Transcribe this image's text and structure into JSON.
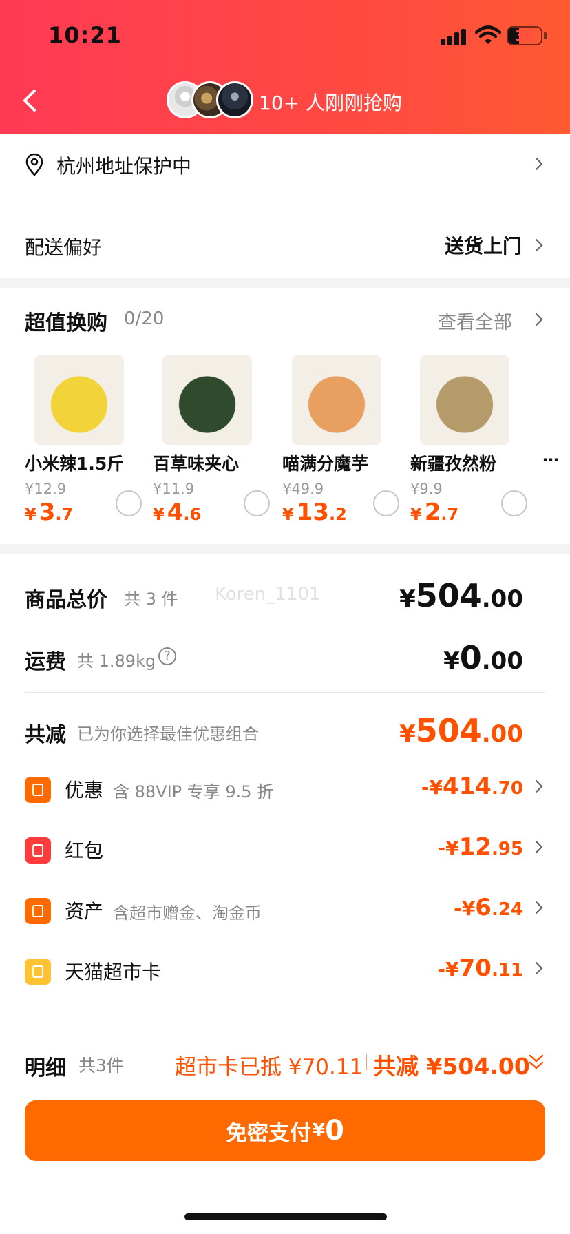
{
  "status_bar": {
    "time": "10:21",
    "battery": "34",
    "battery_level": 0.34
  },
  "header": {
    "buyers_text": "10+ 人刚刚抢购"
  },
  "address": {
    "text": "杭州地址保护中"
  },
  "delivery": {
    "label": "配送偏好",
    "value": "送货上门"
  },
  "upgrade": {
    "title": "超值换购",
    "count": "0/20",
    "view_all": "查看全部",
    "products": [
      {
        "name": "小米辣1.5斤",
        "orig_price": "¥12.9",
        "currency": "¥",
        "price_int": "3",
        "price_dec": ".7",
        "img_color": "#f2d33a"
      },
      {
        "name": "百草味夹心",
        "orig_price": "¥11.9",
        "currency": "¥",
        "price_int": "4",
        "price_dec": ".6",
        "img_color": "#2f4a2c"
      },
      {
        "name": "喵满分魔芋",
        "orig_price": "¥49.9",
        "currency": "¥",
        "price_int": "13",
        "price_dec": ".2",
        "img_color": "#e8a060"
      },
      {
        "name": "新疆孜然粉",
        "orig_price": "¥9.9",
        "currency": "¥",
        "price_int": "2",
        "price_dec": ".7",
        "img_color": "#b59a6a"
      }
    ]
  },
  "watermark": "Koren_1101",
  "totals": {
    "goods_label": "商品总价",
    "goods_sub": "共 3 件",
    "goods_amount": {
      "currency": "¥",
      "int": "504",
      "dec": ".00"
    },
    "shipping_label": "运费",
    "shipping_sub": "共 1.89kg",
    "shipping_help": "?",
    "shipping_amount": {
      "currency": "¥",
      "int": "0",
      "dec": ".00"
    },
    "discount_label": "共减",
    "discount_sub": "已为你选择最佳优惠组合",
    "discount_amount": {
      "currency": "¥",
      "int": "504",
      "dec": ".00"
    }
  },
  "discounts": [
    {
      "label": "优惠",
      "sub": "含 88VIP 专享 9.5 折",
      "sign": "-¥",
      "int": "414",
      "dec": ".70",
      "icon": "coupon-tag-icon",
      "color": "#ff6a00"
    },
    {
      "label": "红包",
      "sub": "",
      "sign": "-¥",
      "int": "12",
      "dec": ".95",
      "icon": "red-packet-icon",
      "color": "#ff3b3b"
    },
    {
      "label": "资产",
      "sub": "含超市赠金、淘金币",
      "sign": "-¥",
      "int": "6",
      "dec": ".24",
      "icon": "asset-yen-icon",
      "color": "#ff6a00"
    },
    {
      "label": "天猫超市卡",
      "sub": "",
      "sign": "-¥",
      "int": "70",
      "dec": ".11",
      "icon": "gift-card-icon",
      "color": "#ffc233"
    }
  ],
  "detail": {
    "label": "明细",
    "sub": "共3件",
    "card_used": "超市卡已抵 ¥70.11",
    "total_reduce": "共减 ¥504.00"
  },
  "pay_button": {
    "label": "免密支付",
    "currency": "¥",
    "amount": "0"
  },
  "colors": {
    "accent": "#ff5000",
    "header_start": "#ff3a55",
    "header_end": "#ff5a32",
    "button": "#ff6a00"
  }
}
